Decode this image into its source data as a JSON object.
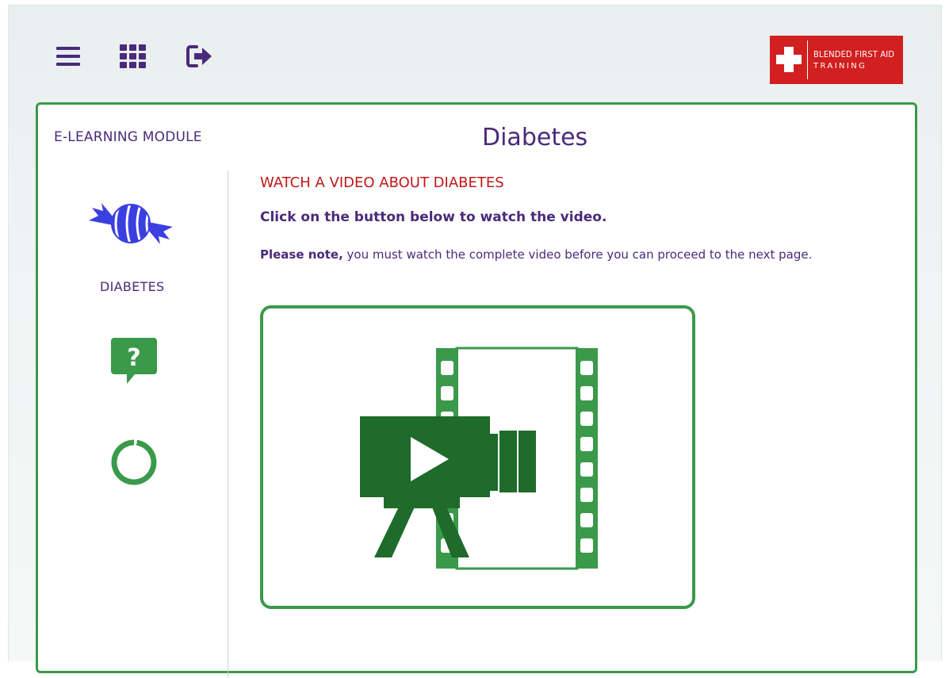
{
  "logo": {
    "line1": "BLENDED FIRST AID",
    "line2": "TRAINING"
  },
  "module": {
    "label": "E-LEARNING MODULE",
    "title": "Diabetes"
  },
  "sidebar": {
    "items": [
      {
        "label": "DIABETES",
        "icon": "candy-icon"
      },
      {
        "label": "",
        "icon": "question-bubble-icon"
      },
      {
        "label": "",
        "icon": "progress-ring-icon",
        "progress": 0.97
      }
    ]
  },
  "content": {
    "heading": "WATCH A VIDEO ABOUT DIABETES",
    "subheading": "Click on the button below to watch the video.",
    "note_bold": "Please note,",
    "note_text": " you must watch the complete video before you can proceed to the next page."
  },
  "colors": {
    "purple": "#4a2a7a",
    "green": "#3a9a4a",
    "dark_green": "#1e6b2a",
    "red": "#c01818",
    "logo_red": "#d21f1f",
    "candy_blue": "#3b3fe0"
  }
}
